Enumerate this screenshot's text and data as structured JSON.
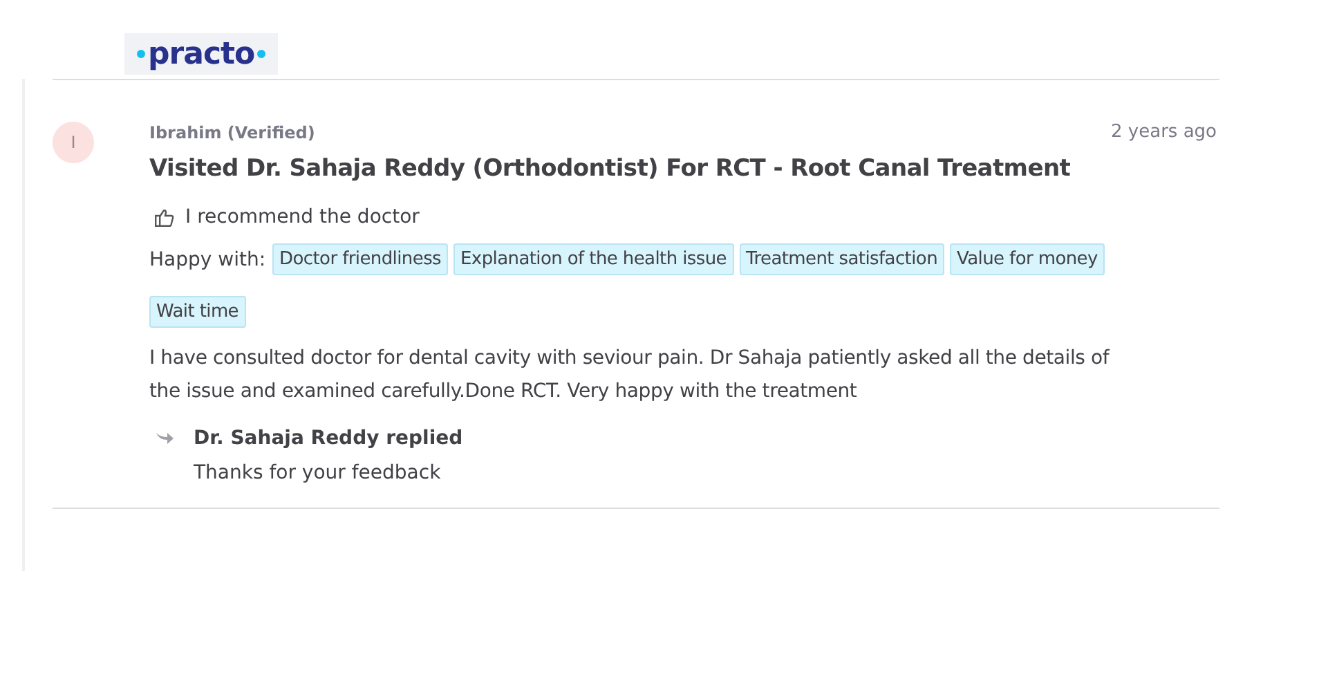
{
  "logo": "practo",
  "review": {
    "avatar_initial": "I",
    "reviewer": "Ibrahim (Verified)",
    "time": "2 years ago",
    "title": "Visited Dr. Sahaja Reddy (Orthodontist) For RCT - Root Canal Treatment",
    "recommendation": "I recommend the doctor",
    "happy_with_label": "Happy with:",
    "tags": [
      "Doctor friendliness",
      "Explanation of the health issue",
      "Treatment satisfaction",
      "Value for money",
      "Wait time"
    ],
    "text": "I have consulted doctor for dental cavity with seviour pain. Dr Sahaja patiently asked all the details of the issue and examined carefully.Done RCT. Very happy with the treatment",
    "reply": {
      "author": "Dr. Sahaja Reddy replied",
      "text": "Thanks for your feedback"
    }
  }
}
